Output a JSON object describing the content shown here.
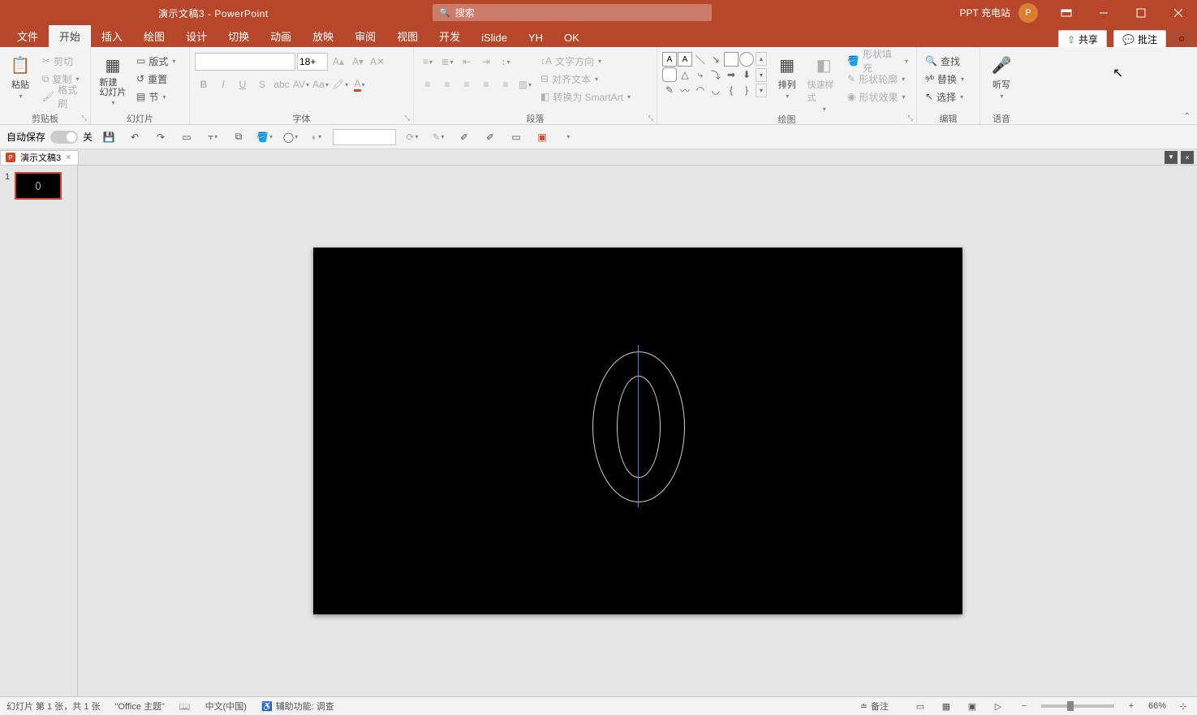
{
  "title": "演示文稿3  -  PowerPoint",
  "search": {
    "placeholder": "搜索"
  },
  "ppt_station": "PPT 充电站",
  "avatar_initial": "P",
  "tabs": {
    "file": "文件",
    "home": "开始",
    "insert": "插入",
    "draw": "绘图",
    "design": "设计",
    "transitions": "切换",
    "animations": "动画",
    "slideshow": "放映",
    "review": "审阅",
    "view": "视图",
    "developer": "开发",
    "islide": "iSlide",
    "yh": "YH",
    "ok": "OK"
  },
  "share": "共享",
  "comments": "批注",
  "groups": {
    "clipboard": {
      "label": "剪贴板",
      "paste": "粘贴",
      "cut": "剪切",
      "copy": "复制",
      "format_painter": "格式刷"
    },
    "slides": {
      "label": "幻灯片",
      "new_slide": "新建\n幻灯片",
      "layout": "版式",
      "reset": "重置",
      "section": "节"
    },
    "font": {
      "label": "字体",
      "size": "18+"
    },
    "paragraph": {
      "label": "段落",
      "text_direction": "文字方向",
      "align_text": "对齐文本",
      "convert_smartart": "转换为 SmartArt"
    },
    "drawing": {
      "label": "绘图",
      "arrange": "排列",
      "quick_styles": "快速样式",
      "shape_fill": "形状填充",
      "shape_outline": "形状轮廓",
      "shape_effects": "形状效果"
    },
    "editing": {
      "label": "编辑",
      "find": "查找",
      "replace": "替换",
      "select": "选择"
    },
    "voice": {
      "label": "语音",
      "dictate": "听写"
    }
  },
  "qat": {
    "autosave": "自动保存",
    "autosave_state": "关"
  },
  "doc_tab": "演示文稿3",
  "thumb": {
    "num": "1"
  },
  "status": {
    "slide_info": "幻灯片 第 1 张，共 1 张",
    "theme": "\"Office 主题\"",
    "lang": "中文(中国)",
    "accessibility": "辅助功能: 调查",
    "notes": "备注",
    "zoom": "66%"
  }
}
